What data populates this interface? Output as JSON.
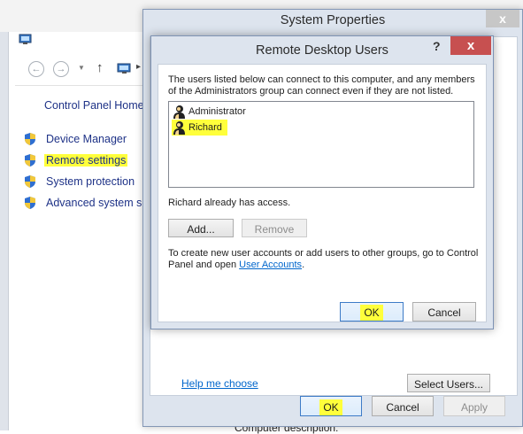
{
  "control_panel": {
    "home_link": "Control Panel Home",
    "nav_back_icon": "arrow-left-icon",
    "nav_forward_icon": "arrow-right-icon",
    "nav_up_icon": "arrow-up-icon",
    "links": [
      {
        "label": "Device Manager",
        "icon": "uac-shield-icon",
        "highlighted": false
      },
      {
        "label": "Remote settings",
        "icon": "uac-shield-icon",
        "highlighted": true
      },
      {
        "label": "System protection",
        "icon": "uac-shield-icon",
        "highlighted": false
      },
      {
        "label": "Advanced system set",
        "icon": "uac-shield-icon",
        "highlighted": false
      }
    ],
    "bottom_text": "Computer description:"
  },
  "system_properties": {
    "title": "System Properties",
    "close_glyph": "x",
    "help_link": "Help me choose",
    "select_users_button": "Select Users...",
    "ok_button": "OK",
    "cancel_button": "Cancel",
    "apply_button": "Apply"
  },
  "remote_desktop_users": {
    "title": "Remote Desktop Users",
    "help_glyph": "?",
    "close_glyph": "x",
    "description": "The users listed below can connect to this computer, and any members of the Administrators group can connect even if they are not listed.",
    "users": [
      {
        "name": "Administrator",
        "icon": "user-icon",
        "highlighted": false
      },
      {
        "name": "Richard",
        "icon": "user-icon",
        "highlighted": true
      }
    ],
    "access_status": "Richard already has access.",
    "add_button": "Add...",
    "remove_button": "Remove",
    "note_prefix": "To create new user accounts or add users to other groups, go to Control Panel and open ",
    "note_link": "User Accounts",
    "note_suffix": ".",
    "ok_button": "OK",
    "cancel_button": "Cancel"
  },
  "colors": {
    "highlight": "#ffff3b",
    "link": "#1e3287",
    "close_red": "#c75050",
    "dialog_bg": "#dde4ee"
  }
}
